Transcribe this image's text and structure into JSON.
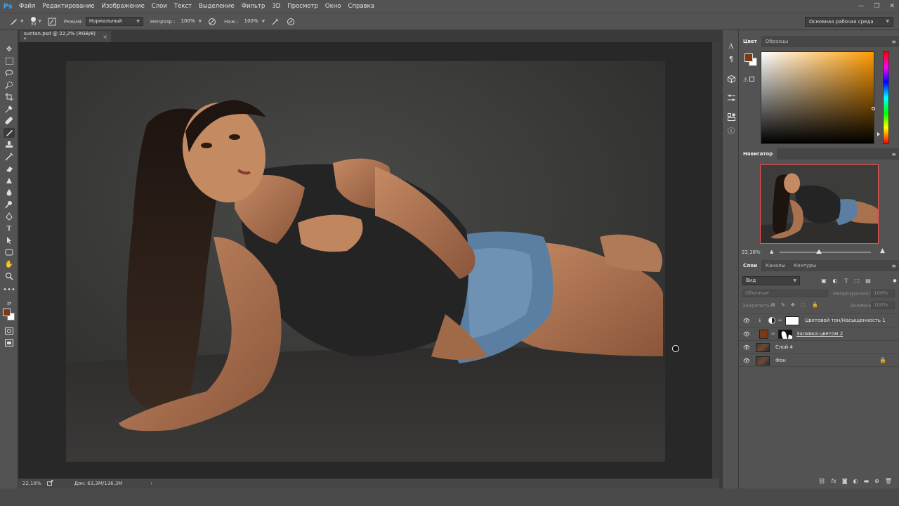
{
  "app": {
    "logo": "Ps"
  },
  "menubar": {
    "items": [
      "Файл",
      "Редактирование",
      "Изображение",
      "Слои",
      "Текст",
      "Выделение",
      "Фильтр",
      "3D",
      "Просмотр",
      "Окно",
      "Справка"
    ],
    "window_controls": [
      "—",
      "❐",
      "✕"
    ]
  },
  "options_bar": {
    "brush_size": "30",
    "mode_label": "Режим:",
    "mode_value": "Нормальный",
    "opacity_label": "Непрозр.:",
    "opacity_value": "100%",
    "flow_label": "Наж.:",
    "flow_value": "100%",
    "workspace": "Основная рабочая среда"
  },
  "document": {
    "tab_title": "suntan.psd @ 22,2% (RGB/8) *",
    "close": "×"
  },
  "status": {
    "zoom": "22,18%",
    "doc_info": "Док: 63,3M/136,3M"
  },
  "panels": {
    "color": {
      "tabs": [
        "Цвет",
        "Образцы"
      ],
      "foreground": "#7a3a12",
      "background": "#ffffff"
    },
    "navigator": {
      "title": "Навигатор",
      "zoom": "22,18%"
    },
    "layers": {
      "tabs": [
        "Слои",
        "Каналы",
        "Контуры"
      ],
      "filter": "Вид",
      "blend_mode": "Обычные",
      "opacity_label": "Непрозрачность:",
      "opacity_value": "100%",
      "lock_label": "Закрепить:",
      "fill_label": "Заливка:",
      "fill_value": "100%",
      "items": [
        {
          "name": "Цветовой тон/Насыщенность 1",
          "type": "adjustment"
        },
        {
          "name": "Заливка цветом 2",
          "type": "fill",
          "color": "#7a3a12"
        },
        {
          "name": "Слой 4",
          "type": "pixel"
        },
        {
          "name": "Фон",
          "type": "background",
          "locked": true
        }
      ]
    }
  },
  "icons": {
    "tools": [
      "move-icon",
      "marquee-icon",
      "lasso-icon",
      "quick-select-icon",
      "crop-icon",
      "eyedropper-icon",
      "healing-icon",
      "brush-icon",
      "stamp-icon",
      "history-brush-icon",
      "eraser-icon",
      "gradient-icon",
      "blur-icon",
      "dodge-icon",
      "pen-icon",
      "type-icon",
      "path-select-icon",
      "shape-icon",
      "hand-icon",
      "zoom-icon",
      "more-icon"
    ]
  }
}
